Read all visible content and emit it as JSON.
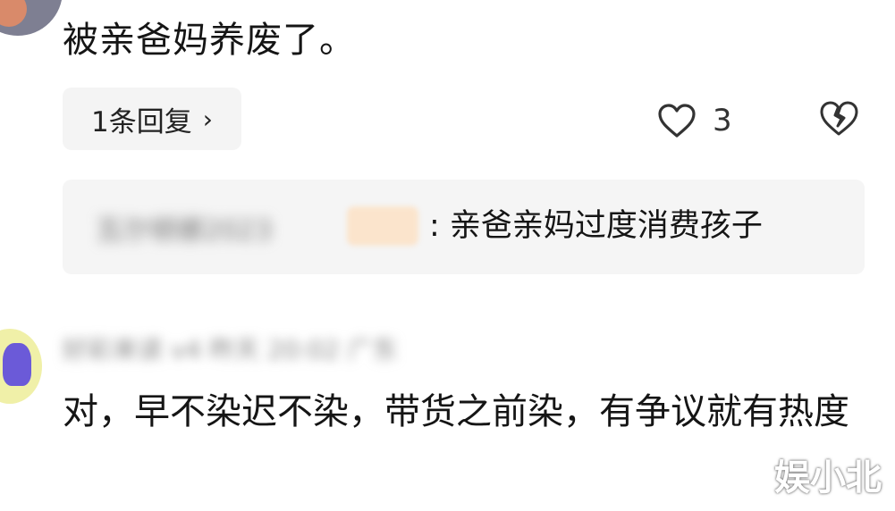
{
  "comment1": {
    "text": "被亲爸妈养废了。",
    "reply_button": "1条回复",
    "reply_chevron": "›",
    "like_count": "3",
    "icons": {
      "like": "heart-icon",
      "dislike": "broken-heart-icon"
    }
  },
  "quote": {
    "username_blurred": "瓦尔顿娜2023",
    "text": ": 亲爸亲妈过度消费孩子"
  },
  "comment2": {
    "meta_blurred": "好彩来读 v4 昨天 20:02 广东",
    "text": "对，早不染迟不染，带货之前染，有争议就有热度"
  },
  "watermark": "娱小北"
}
